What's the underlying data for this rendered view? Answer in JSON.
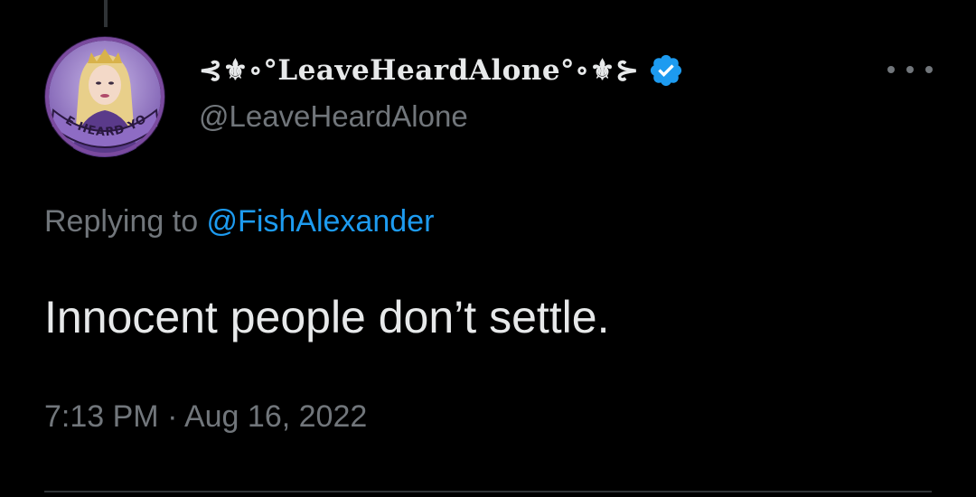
{
  "author": {
    "display_name": "⊰⚜∘°LeaveHeardAlone°∘⚜⊱",
    "handle": "@LeaveHeardAlone",
    "avatar_caption": "WE HEARD YOU",
    "verified_icon": "verified-badge-icon"
  },
  "reply": {
    "prefix": "Replying to ",
    "target": "@FishAlexander"
  },
  "tweet": {
    "text": "Innocent people don’t settle.",
    "time": "7:13 PM",
    "separator": " · ",
    "date": "Aug 16, 2022"
  },
  "colors": {
    "background": "#000000",
    "primary_text": "#e7e9ea",
    "secondary_text": "#71767b",
    "link": "#1d9bf0",
    "avatar_ring": "#7a4a9e"
  },
  "icons": {
    "more": "more-dots-icon",
    "verified": "verified-badge-icon"
  }
}
